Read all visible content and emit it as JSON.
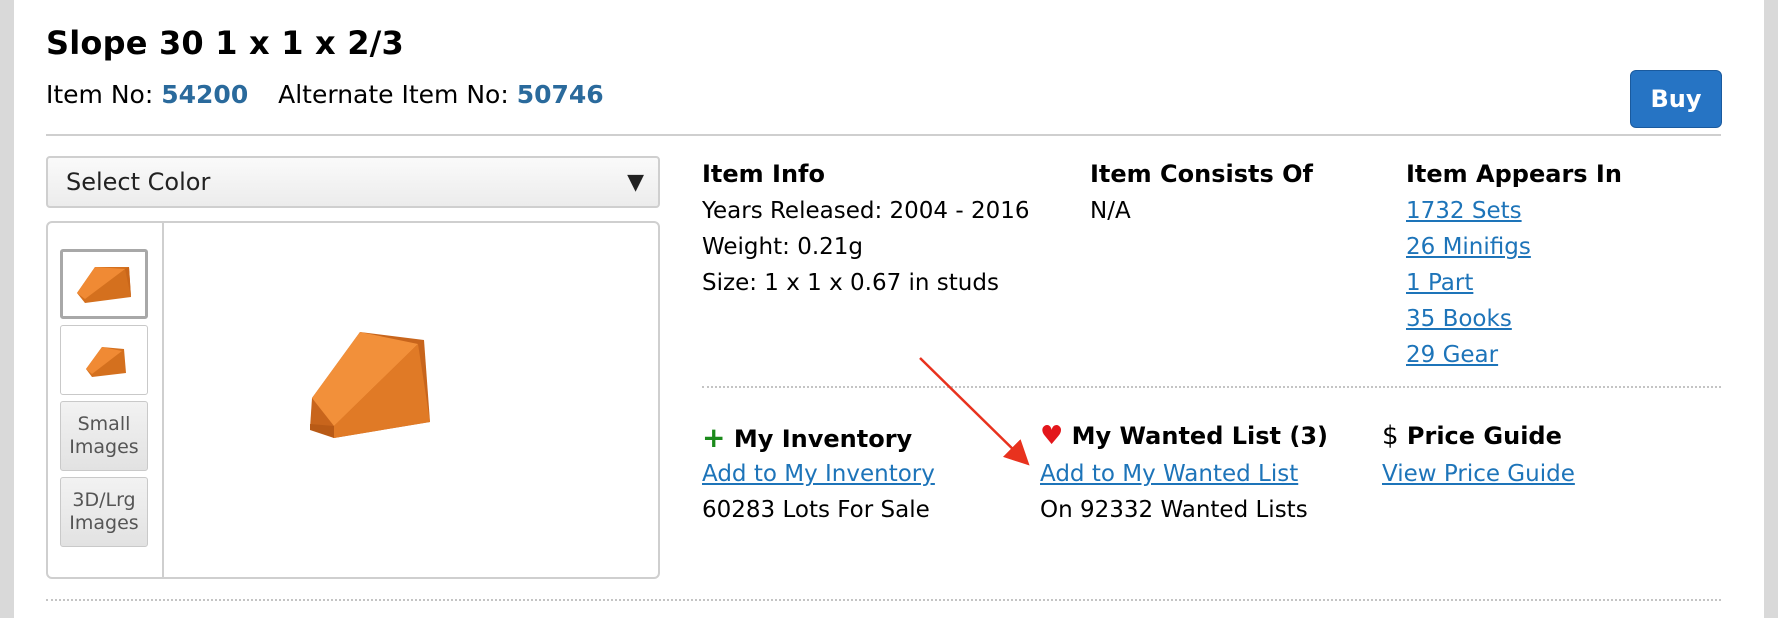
{
  "item": {
    "title": "Slope 30 1 x 1 x 2/3",
    "item_no_label": "Item No:",
    "item_no": "54200",
    "alt_item_no_label": "Alternate Item No:",
    "alt_item_no": "50746"
  },
  "buy_label": "Buy",
  "color_select": {
    "label": "Select Color"
  },
  "gallery": {
    "small_images_label": "Small Images",
    "large_images_label": "3D/Lrg Images"
  },
  "item_info": {
    "heading": "Item Info",
    "years_released": "Years Released: 2004 - 2016",
    "weight": "Weight: 0.21g",
    "size": "Size: 1 x 1 x 0.67 in studs"
  },
  "consists_of": {
    "heading": "Item Consists Of",
    "value": "N/A"
  },
  "appears_in": {
    "heading": "Item Appears In",
    "links": [
      "1732 Sets",
      "26 Minifigs",
      "1 Part",
      "35 Books",
      "29 Gear"
    ]
  },
  "inventory": {
    "icon": "+",
    "heading": "My Inventory",
    "link": "Add to My Inventory",
    "lots": "60283 Lots For Sale"
  },
  "wanted": {
    "icon": "♥",
    "heading": "My Wanted List (3)",
    "link": "Add to My Wanted List",
    "lists": "On 92332 Wanted Lists"
  },
  "price_guide": {
    "icon": "$",
    "heading": "Price Guide",
    "link": "View Price Guide"
  },
  "colors": {
    "link": "#1d74b9",
    "item_number": "#2a6a9c",
    "buy_button": "#2674c4",
    "heart": "#e3161b",
    "plus": "#1b8a1b",
    "annotation_arrow": "#e8321e",
    "brick": "#e8832e"
  }
}
